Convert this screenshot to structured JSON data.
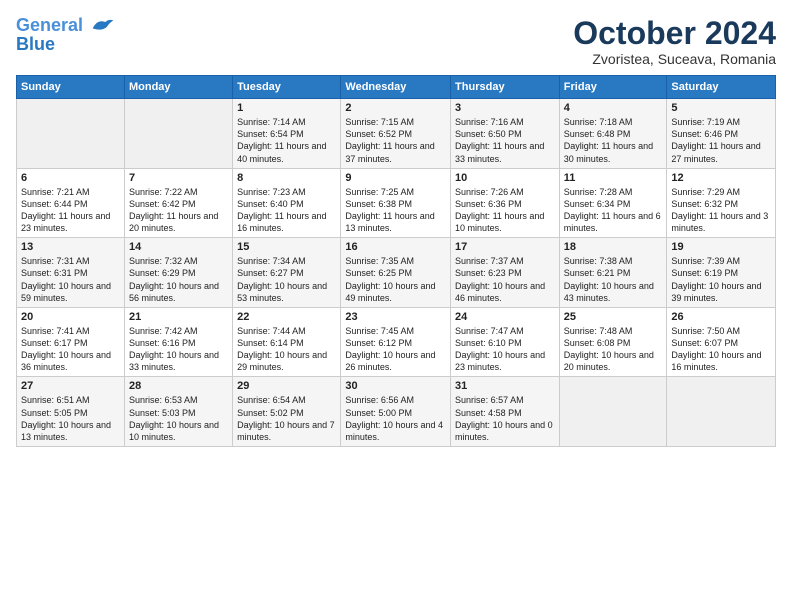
{
  "header": {
    "logo_line1": "General",
    "logo_line2": "Blue",
    "month": "October 2024",
    "location": "Zvoristea, Suceava, Romania"
  },
  "weekdays": [
    "Sunday",
    "Monday",
    "Tuesday",
    "Wednesday",
    "Thursday",
    "Friday",
    "Saturday"
  ],
  "rows": [
    [
      {
        "day": "",
        "info": ""
      },
      {
        "day": "",
        "info": ""
      },
      {
        "day": "1",
        "info": "Sunrise: 7:14 AM\nSunset: 6:54 PM\nDaylight: 11 hours and 40 minutes."
      },
      {
        "day": "2",
        "info": "Sunrise: 7:15 AM\nSunset: 6:52 PM\nDaylight: 11 hours and 37 minutes."
      },
      {
        "day": "3",
        "info": "Sunrise: 7:16 AM\nSunset: 6:50 PM\nDaylight: 11 hours and 33 minutes."
      },
      {
        "day": "4",
        "info": "Sunrise: 7:18 AM\nSunset: 6:48 PM\nDaylight: 11 hours and 30 minutes."
      },
      {
        "day": "5",
        "info": "Sunrise: 7:19 AM\nSunset: 6:46 PM\nDaylight: 11 hours and 27 minutes."
      }
    ],
    [
      {
        "day": "6",
        "info": "Sunrise: 7:21 AM\nSunset: 6:44 PM\nDaylight: 11 hours and 23 minutes."
      },
      {
        "day": "7",
        "info": "Sunrise: 7:22 AM\nSunset: 6:42 PM\nDaylight: 11 hours and 20 minutes."
      },
      {
        "day": "8",
        "info": "Sunrise: 7:23 AM\nSunset: 6:40 PM\nDaylight: 11 hours and 16 minutes."
      },
      {
        "day": "9",
        "info": "Sunrise: 7:25 AM\nSunset: 6:38 PM\nDaylight: 11 hours and 13 minutes."
      },
      {
        "day": "10",
        "info": "Sunrise: 7:26 AM\nSunset: 6:36 PM\nDaylight: 11 hours and 10 minutes."
      },
      {
        "day": "11",
        "info": "Sunrise: 7:28 AM\nSunset: 6:34 PM\nDaylight: 11 hours and 6 minutes."
      },
      {
        "day": "12",
        "info": "Sunrise: 7:29 AM\nSunset: 6:32 PM\nDaylight: 11 hours and 3 minutes."
      }
    ],
    [
      {
        "day": "13",
        "info": "Sunrise: 7:31 AM\nSunset: 6:31 PM\nDaylight: 10 hours and 59 minutes."
      },
      {
        "day": "14",
        "info": "Sunrise: 7:32 AM\nSunset: 6:29 PM\nDaylight: 10 hours and 56 minutes."
      },
      {
        "day": "15",
        "info": "Sunrise: 7:34 AM\nSunset: 6:27 PM\nDaylight: 10 hours and 53 minutes."
      },
      {
        "day": "16",
        "info": "Sunrise: 7:35 AM\nSunset: 6:25 PM\nDaylight: 10 hours and 49 minutes."
      },
      {
        "day": "17",
        "info": "Sunrise: 7:37 AM\nSunset: 6:23 PM\nDaylight: 10 hours and 46 minutes."
      },
      {
        "day": "18",
        "info": "Sunrise: 7:38 AM\nSunset: 6:21 PM\nDaylight: 10 hours and 43 minutes."
      },
      {
        "day": "19",
        "info": "Sunrise: 7:39 AM\nSunset: 6:19 PM\nDaylight: 10 hours and 39 minutes."
      }
    ],
    [
      {
        "day": "20",
        "info": "Sunrise: 7:41 AM\nSunset: 6:17 PM\nDaylight: 10 hours and 36 minutes."
      },
      {
        "day": "21",
        "info": "Sunrise: 7:42 AM\nSunset: 6:16 PM\nDaylight: 10 hours and 33 minutes."
      },
      {
        "day": "22",
        "info": "Sunrise: 7:44 AM\nSunset: 6:14 PM\nDaylight: 10 hours and 29 minutes."
      },
      {
        "day": "23",
        "info": "Sunrise: 7:45 AM\nSunset: 6:12 PM\nDaylight: 10 hours and 26 minutes."
      },
      {
        "day": "24",
        "info": "Sunrise: 7:47 AM\nSunset: 6:10 PM\nDaylight: 10 hours and 23 minutes."
      },
      {
        "day": "25",
        "info": "Sunrise: 7:48 AM\nSunset: 6:08 PM\nDaylight: 10 hours and 20 minutes."
      },
      {
        "day": "26",
        "info": "Sunrise: 7:50 AM\nSunset: 6:07 PM\nDaylight: 10 hours and 16 minutes."
      }
    ],
    [
      {
        "day": "27",
        "info": "Sunrise: 6:51 AM\nSunset: 5:05 PM\nDaylight: 10 hours and 13 minutes."
      },
      {
        "day": "28",
        "info": "Sunrise: 6:53 AM\nSunset: 5:03 PM\nDaylight: 10 hours and 10 minutes."
      },
      {
        "day": "29",
        "info": "Sunrise: 6:54 AM\nSunset: 5:02 PM\nDaylight: 10 hours and 7 minutes."
      },
      {
        "day": "30",
        "info": "Sunrise: 6:56 AM\nSunset: 5:00 PM\nDaylight: 10 hours and 4 minutes."
      },
      {
        "day": "31",
        "info": "Sunrise: 6:57 AM\nSunset: 4:58 PM\nDaylight: 10 hours and 0 minutes."
      },
      {
        "day": "",
        "info": ""
      },
      {
        "day": "",
        "info": ""
      }
    ]
  ]
}
